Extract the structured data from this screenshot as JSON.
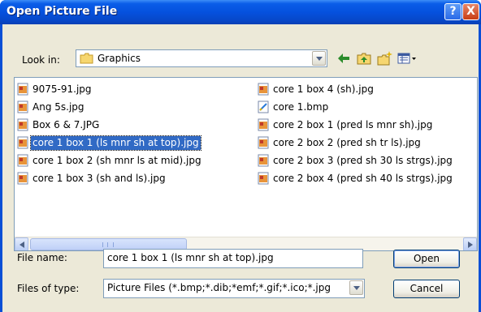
{
  "window": {
    "title": "Open Picture File"
  },
  "titlebar": {
    "help_glyph": "?",
    "close_glyph": "X"
  },
  "lookin": {
    "label": "Look in:",
    "value": "Graphics"
  },
  "toolbar": {
    "icons": [
      "back-icon",
      "up-folder-icon",
      "new-folder-icon",
      "view-menu-icon"
    ]
  },
  "files": [
    {
      "name": "9075-91.jpg",
      "type": "jpg"
    },
    {
      "name": "Ang 5s.jpg",
      "type": "jpg"
    },
    {
      "name": "Box 6 & 7.JPG",
      "type": "jpg"
    },
    {
      "name": "core 1 box 1 (ls mnr sh at top).jpg",
      "type": "jpg",
      "selected": true
    },
    {
      "name": "core 1 box 2 (sh mnr ls at mid).jpg",
      "type": "jpg"
    },
    {
      "name": "core 1 box 3 (sh and ls).jpg",
      "type": "jpg"
    },
    {
      "name": "core 1 box 4 (sh).jpg",
      "type": "jpg"
    },
    {
      "name": "core 1.bmp",
      "type": "bmp"
    },
    {
      "name": "core 2 box 1 (pred ls mnr sh).jpg",
      "type": "jpg"
    },
    {
      "name": "core 2 box 2 (pred sh tr ls).jpg",
      "type": "jpg"
    },
    {
      "name": "core 2 box 3 (pred sh 30 ls strgs).jpg",
      "type": "jpg"
    },
    {
      "name": "core 2 box 4 (pred sh 40 ls strgs).jpg",
      "type": "jpg"
    }
  ],
  "filename": {
    "label": "File name:",
    "value": "core 1 box 1 (ls mnr sh at top).jpg"
  },
  "filetype": {
    "label": "Files of type:",
    "value": "Picture Files (*.bmp;*.dib;*emf;*.gif;*.ico;*.jpg"
  },
  "buttons": {
    "open": "Open",
    "cancel": "Cancel"
  },
  "colors": {
    "titlebar": "#0a5de8",
    "face": "#ece9d8",
    "selection": "#316ac5",
    "border": "#7f9db9"
  }
}
